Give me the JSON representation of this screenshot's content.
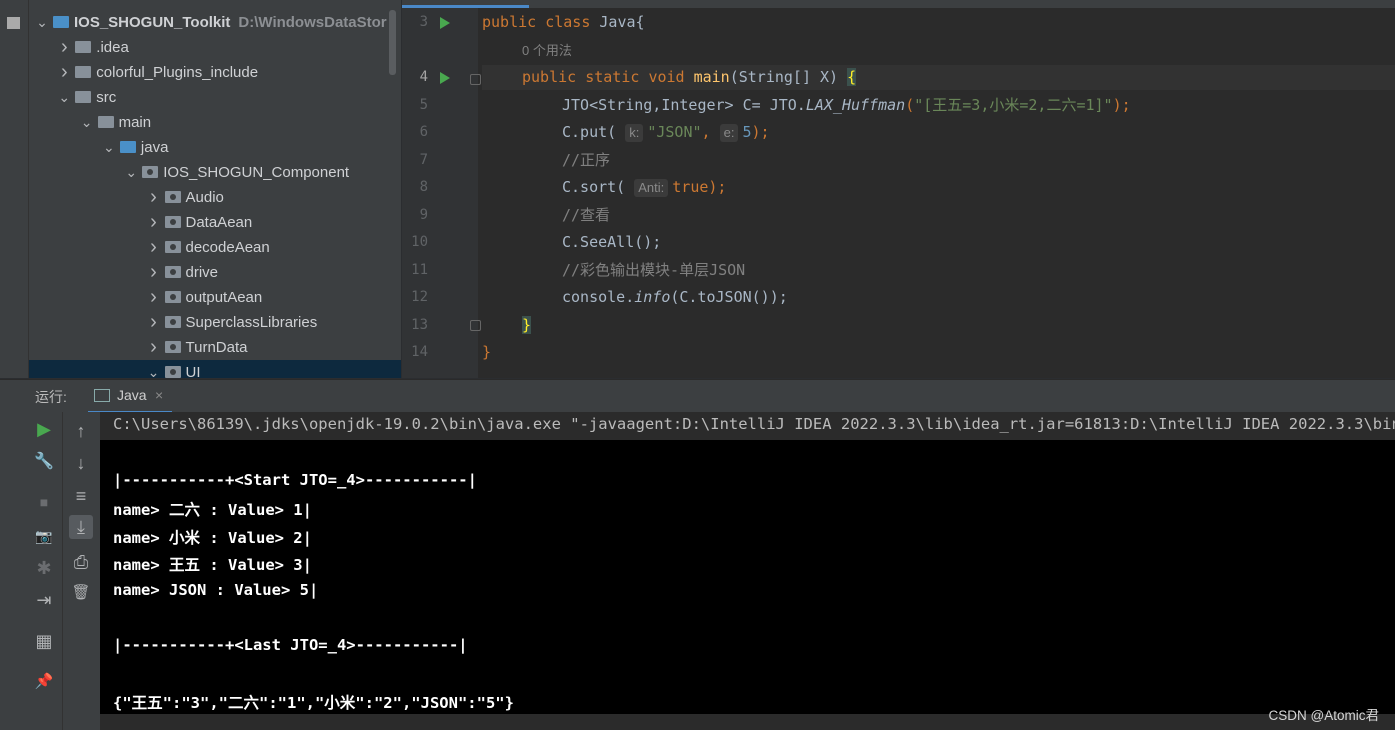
{
  "tree": {
    "items": [
      {
        "label": "IOS_SHOGUN_Toolkit",
        "path": "D:\\WindowsDataStor",
        "arrow": "⌄",
        "kind": "module",
        "indent": 0
      },
      {
        "label": ".idea",
        "arrow": "›",
        "kind": "folder",
        "indent": 1
      },
      {
        "label": "colorful_Plugins_include",
        "arrow": "›",
        "kind": "folder",
        "indent": 1
      },
      {
        "label": "src",
        "arrow": "⌄",
        "kind": "folder",
        "indent": 1
      },
      {
        "label": "main",
        "arrow": "⌄",
        "kind": "folder",
        "indent": 2
      },
      {
        "label": "java",
        "arrow": "⌄",
        "kind": "source-root",
        "indent": 3
      },
      {
        "label": "IOS_SHOGUN_Component",
        "arrow": "⌄",
        "kind": "package",
        "indent": 4
      },
      {
        "label": "Audio",
        "arrow": "›",
        "kind": "package",
        "indent": 5
      },
      {
        "label": "DataAean",
        "arrow": "›",
        "kind": "package",
        "indent": 5
      },
      {
        "label": "decodeAean",
        "arrow": "›",
        "kind": "package",
        "indent": 5
      },
      {
        "label": "drive",
        "arrow": "›",
        "kind": "package",
        "indent": 5
      },
      {
        "label": "outputAean",
        "arrow": "›",
        "kind": "package",
        "indent": 5
      },
      {
        "label": "SuperclassLibraries",
        "arrow": "›",
        "kind": "package",
        "indent": 5
      },
      {
        "label": "TurnData",
        "arrow": "›",
        "kind": "package",
        "indent": 5
      },
      {
        "label": "UI",
        "arrow": "⌄",
        "kind": "package",
        "indent": 5
      }
    ]
  },
  "editor": {
    "usage_hint": "0 个用法",
    "line_numbers": [
      "3",
      "4",
      "5",
      "6",
      "7",
      "8",
      "9",
      "10",
      "11",
      "12",
      "13",
      "14"
    ],
    "hints": {
      "k": "k:",
      "e": "e:",
      "anti": "Anti:"
    },
    "tokens": {
      "public": "public",
      "class": "class",
      "classname": "Java{",
      "static": "static",
      "void": "void",
      "main": "main",
      "params": "(String[] X) ",
      "brace_open": "{",
      "brace_close": "}",
      "class_close": "}",
      "l5_a": "JTO<String,Integer> C= JTO.",
      "l5_m": "LAX_Huffman",
      "l5_p1": "(",
      "l5_s": "\"[王五=3,小米=2,二六=1]\"",
      "l5_p2": ");",
      "l6_a": "C.put( ",
      "l6_s": "\"JSON\"",
      "l6_c": ", ",
      "l6_n": "5",
      "l6_e": ");",
      "l7": "//正序",
      "l8_a": "C.sort( ",
      "l8_v": "true",
      "l8_e": ");",
      "l9": "//查看",
      "l10": "C.SeeAll();",
      "l11": "//彩色输出模块-单层JSON",
      "l12_a": "console.",
      "l12_m": "info",
      "l12_b": "(C.toJSON());"
    }
  },
  "run": {
    "label": "运行:",
    "tab": "Java",
    "tab_close": "×",
    "command": "C:\\Users\\86139\\.jdks\\openjdk-19.0.2\\bin\\java.exe \"-javaagent:D:\\IntelliJ IDEA 2022.3.3\\lib\\idea_rt.jar=61813:D:\\IntelliJ IDEA 2022.3.3\\bin\"",
    "output": [
      "",
      "|-----------+<Start JTO=_4>-----------|",
      "name> 二六 : Value> 1|",
      "name> 小米 : Value> 2|",
      "name> 王五 : Value> 3|",
      "name> JSON : Value> 5|",
      "",
      "|-----------+<Last JTO=_4>-----------|",
      "",
      "{\"王五\":\"3\",\"二六\":\"1\",\"小米\":\"2\",\"JSON\":\"5\"}"
    ]
  },
  "toolbar_left": {
    "run": "▶",
    "wrench": "🔧",
    "stop": "■",
    "camera": "📷",
    "bug": "✱",
    "exit": "⇥",
    "layout": "▦",
    "pin": "📌"
  },
  "toolbar_right": {
    "up": "↑",
    "down": "↓",
    "wrap": "≡",
    "scroll_end": "⤓",
    "print": "⎙",
    "trash": "🗑"
  },
  "watermark": "CSDN @Atomic君"
}
